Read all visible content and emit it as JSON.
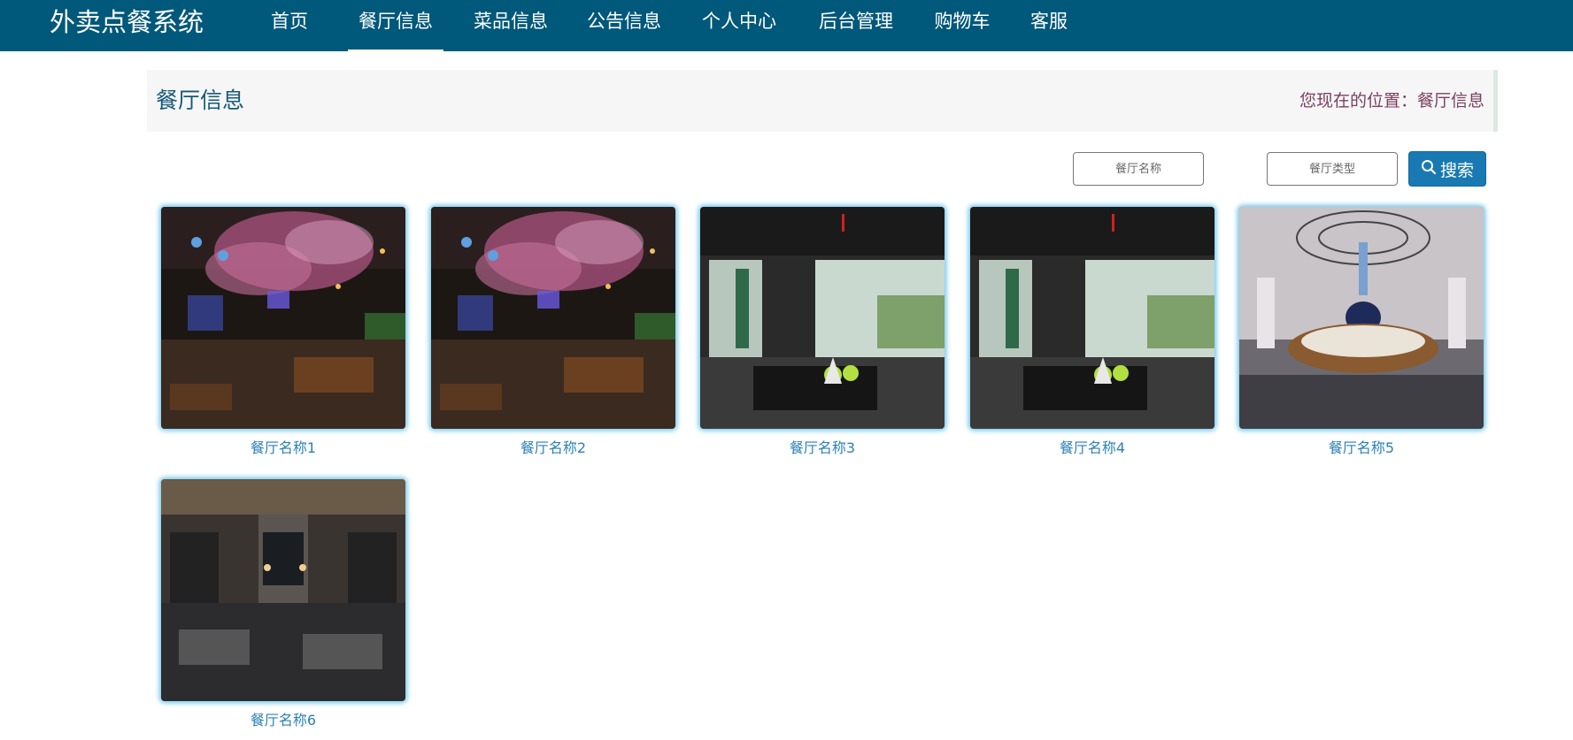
{
  "header": {
    "brand": "外卖点餐系统",
    "nav": [
      {
        "label": "首页",
        "active": false
      },
      {
        "label": "餐厅信息",
        "active": true
      },
      {
        "label": "菜品信息",
        "active": false
      },
      {
        "label": "公告信息",
        "active": false
      },
      {
        "label": "个人中心",
        "active": false
      },
      {
        "label": "后台管理",
        "active": false
      },
      {
        "label": "购物车",
        "active": false
      },
      {
        "label": "客服",
        "active": false
      }
    ]
  },
  "page": {
    "title": "餐厅信息",
    "location": "您现在的位置：餐厅信息"
  },
  "search": {
    "name_placeholder": "餐厅名称",
    "type_placeholder": "餐厅类型",
    "button_label": "搜索",
    "button_icon": "search-icon"
  },
  "restaurants": [
    {
      "name": "餐厅名称1",
      "photo": "neon-bar-cherry-blossom"
    },
    {
      "name": "餐厅名称2",
      "photo": "neon-bar-cherry-blossom"
    },
    {
      "name": "餐厅名称3",
      "photo": "modern-dining-window"
    },
    {
      "name": "餐厅名称4",
      "photo": "modern-dining-window"
    },
    {
      "name": "餐厅名称5",
      "photo": "round-banquet-room"
    },
    {
      "name": "餐厅名称6",
      "photo": "dark-wood-dining-hall"
    }
  ],
  "colors": {
    "topbar": "#00587a",
    "accent": "#197ab3",
    "link": "#2c80b4",
    "breadcrumb": "#7b3f5f"
  }
}
